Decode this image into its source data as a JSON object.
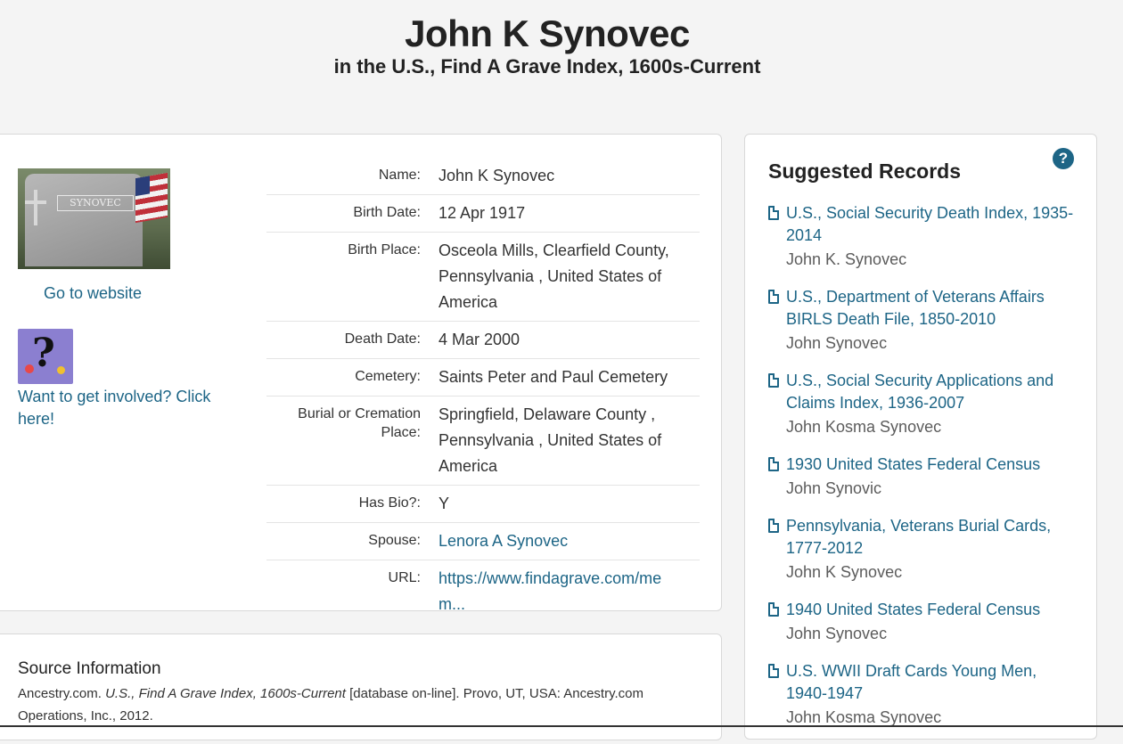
{
  "header": {
    "title": "John K Synovec",
    "subtitle": "in the U.S., Find A Grave Index, 1600s-Current"
  },
  "left_panel": {
    "headstone_text": "SYNOVEC",
    "go_to_website": "Go to website",
    "involve_link": "Want to get involved? Click here!"
  },
  "facts": [
    {
      "label": "Name:",
      "value": "John K Synovec",
      "link": false
    },
    {
      "label": "Birth Date:",
      "value": "12 Apr 1917",
      "link": false
    },
    {
      "label": "Birth Place:",
      "value": "Osceola Mills, Clearfield County, Pennsylvania , United States of America",
      "link": false
    },
    {
      "label": "Death Date:",
      "value": "4 Mar 2000",
      "link": false
    },
    {
      "label": "Cemetery:",
      "value": "Saints Peter and Paul Cemetery",
      "link": false
    },
    {
      "label": "Burial or Cremation Place:",
      "value": "Springfield, Delaware County , Pennsylvania , United States of America",
      "link": false
    },
    {
      "label": "Has Bio?:",
      "value": "Y",
      "link": false
    },
    {
      "label": "Spouse:",
      "value": "Lenora A Synovec",
      "link": true
    },
    {
      "label": "URL:",
      "value": "https://www.findagrave.com/mem...",
      "link": true
    }
  ],
  "source": {
    "title": "Source Information",
    "text_before": "Ancestry.com. ",
    "text_italic": "U.S., Find A Grave Index, 1600s-Current",
    "text_after": " [database on-line]. Provo, UT, USA: Ancestry.com Operations, Inc., 2012."
  },
  "suggested": {
    "title": "Suggested Records",
    "help_icon": "question-circle-icon",
    "records": [
      {
        "title": "U.S., Social Security Death Index, 1935-2014",
        "name": "John K. Synovec"
      },
      {
        "title": "U.S., Department of Veterans Affairs BIRLS Death File, 1850-2010",
        "name": "John Synovec"
      },
      {
        "title": "U.S., Social Security Applications and Claims Index, 1936-2007",
        "name": "John Kosma Synovec"
      },
      {
        "title": "1930 United States Federal Census",
        "name": "John Synovic"
      },
      {
        "title": "Pennsylvania, Veterans Burial Cards, 1777-2012",
        "name": "John K Synovec"
      },
      {
        "title": "1940 United States Federal Census",
        "name": "John Synovec"
      },
      {
        "title": "U.S. WWII Draft Cards Young Men, 1940-1947",
        "name": "John Kosma Synovec"
      }
    ]
  },
  "colors": {
    "link": "#1d6586",
    "background": "#f4f4f4"
  }
}
